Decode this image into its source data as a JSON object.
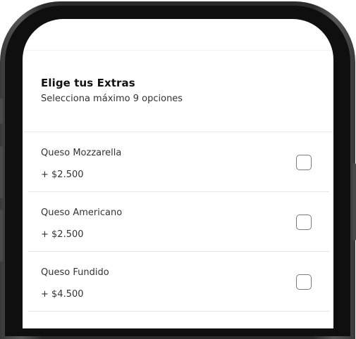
{
  "extras": {
    "title": "Elige tus Extras",
    "subtitle": "Selecciona máximo 9 opciones"
  },
  "options": [
    {
      "name": "Queso Mozzarella",
      "price": "+ $2.500",
      "checked": false
    },
    {
      "name": "Queso Americano",
      "price": "+ $2.500",
      "checked": false
    },
    {
      "name": "Queso Fundido",
      "price": "+ $4.500",
      "checked": false
    }
  ]
}
